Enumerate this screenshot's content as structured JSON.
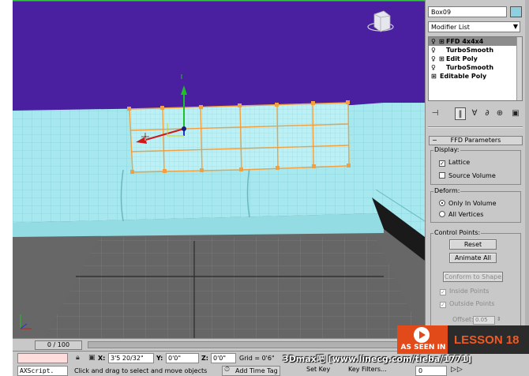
{
  "command_panel": {
    "object_name": "Box09",
    "object_color": "#8fd0e0",
    "modifier_list_label": "Modifier List",
    "stack": [
      {
        "label": "FFD 4x4x4",
        "has_plus": true,
        "selected": true
      },
      {
        "label": "TurboSmooth",
        "has_plus": false,
        "selected": false
      },
      {
        "label": "Edit Poly",
        "has_plus": true,
        "selected": false
      },
      {
        "label": "TurboSmooth",
        "has_plus": false,
        "selected": false
      },
      {
        "label": "Editable Poly",
        "has_plus": true,
        "selected": false,
        "no_bulb": true
      }
    ],
    "rollout_title": "FFD Parameters",
    "display": {
      "title": "Display:",
      "lattice": "Lattice",
      "lattice_checked": true,
      "source_volume": "Source Volume",
      "source_volume_checked": false
    },
    "deform": {
      "title": "Deform:",
      "only_in_volume": "Only In Volume",
      "all_vertices": "All Vertices",
      "selected": "only_in_volume"
    },
    "control_points": {
      "title": "Control Points:",
      "reset": "Reset",
      "animate_all": "Animate All",
      "conform_to_shape": "Conform to Shape",
      "inside_points": "Inside Points",
      "outside_points": "Outside Points",
      "offset_label": "Offset:",
      "offset_value": "0.05"
    }
  },
  "timebar": {
    "frame_readout": "0 / 100"
  },
  "statusbar": {
    "maxscript_text": "AXScript.",
    "x_label": "X:",
    "x_value": "3'5 20/32\"",
    "y_label": "Y:",
    "y_value": "0'0\"",
    "z_label": "Z:",
    "z_value": "0'0\"",
    "grid": "Grid = 0'6\"",
    "prompt": "Click and drag to select and move objects",
    "add_time_tag": "Add Time Tag",
    "set_key": "Set Key",
    "key_filters": "Key Filters...",
    "frame": "0"
  },
  "overlay": {
    "watermark": "3Dmax吧  [www.linecg.com/tieba/1771]",
    "as_seen_in": "AS SEEN IN",
    "lesson": "LESSON 18"
  },
  "colors": {
    "viewport_bg": "#4a1fa0",
    "sofa": "#9fe4ea",
    "lattice": "#f0a040",
    "floor": "#6b6b6b"
  }
}
